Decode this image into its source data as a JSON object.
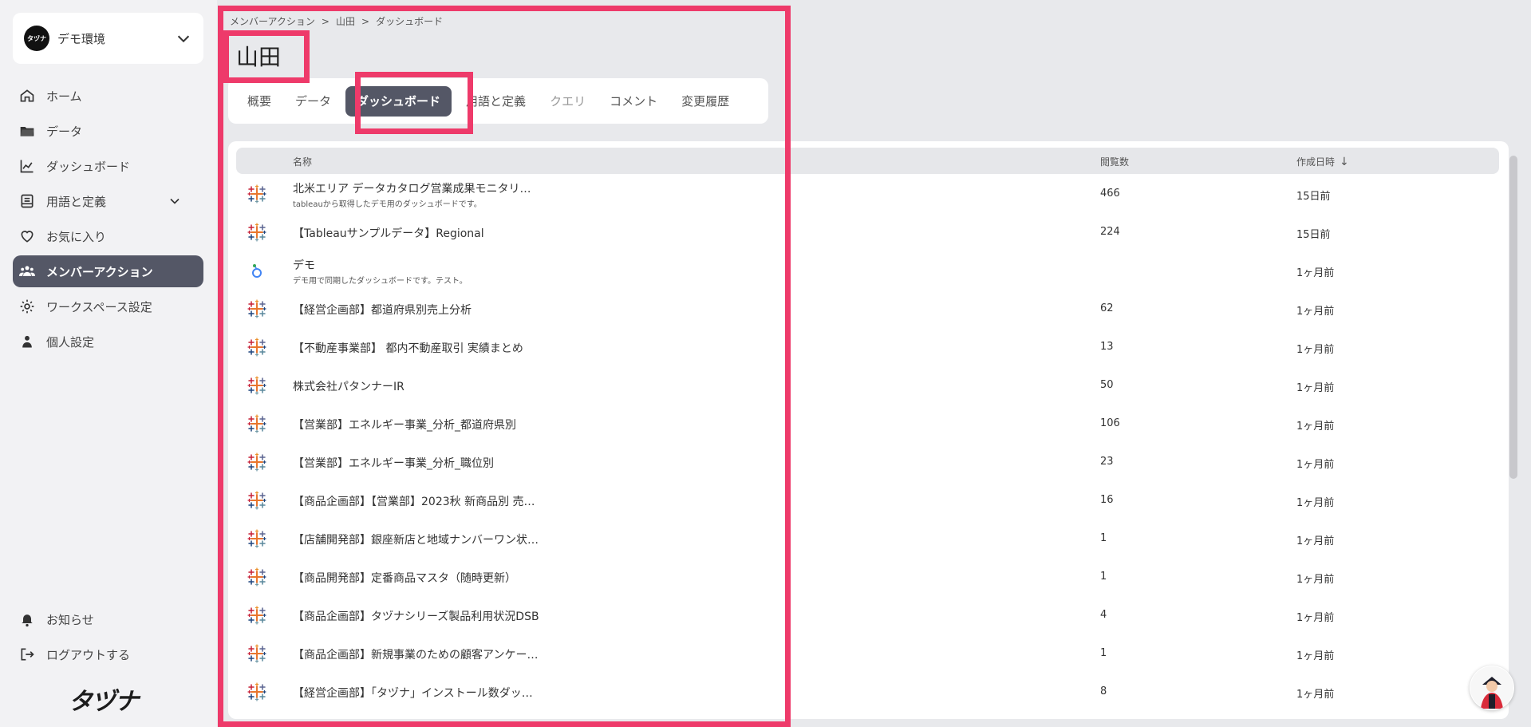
{
  "sidebar": {
    "env_logo_text": "タヅナ",
    "env_name": "デモ環境",
    "nav": [
      {
        "label": "ホーム",
        "icon": "home-icon"
      },
      {
        "label": "データ",
        "icon": "folder-icon"
      },
      {
        "label": "ダッシュボード",
        "icon": "chart-icon"
      },
      {
        "label": "用語と定義",
        "icon": "book-icon"
      },
      {
        "label": "お気に入り",
        "icon": "heart-icon"
      },
      {
        "label": "メンバーアクション",
        "icon": "users-icon",
        "active": true
      },
      {
        "label": "ワークスペース設定",
        "icon": "gear-icon"
      },
      {
        "label": "個人設定",
        "icon": "person-icon"
      }
    ],
    "bottom": [
      {
        "label": "お知らせ",
        "icon": "bell-icon"
      },
      {
        "label": "ログアウトする",
        "icon": "logout-icon"
      }
    ],
    "brand": "タヅナ"
  },
  "breadcrumb": [
    "メンバーアクション",
    "山田",
    "ダッシュボード"
  ],
  "page_title": "山田",
  "tabs": [
    {
      "label": "概要"
    },
    {
      "label": "データ"
    },
    {
      "label": "ダッシュボード",
      "active": true
    },
    {
      "label": "用語と定義"
    },
    {
      "label": "クエリ",
      "disabled": true
    },
    {
      "label": "コメント"
    },
    {
      "label": "変更履歴"
    }
  ],
  "table": {
    "headers": {
      "name": "名称",
      "views": "閲覧数",
      "created": "作成日時"
    },
    "rows": [
      {
        "title": "北米エリア データカタログ営業成果モニタリ…",
        "desc": "tableauから取得したデモ用のダッシュボードです。",
        "views": "466",
        "created": "15日前",
        "icon": "tableau-icon"
      },
      {
        "title": "【Tableauサンプルデータ】Regional",
        "desc": "",
        "views": "224",
        "created": "15日前",
        "icon": "tableau-icon"
      },
      {
        "title": "デモ",
        "desc": "デモ用で同期したダッシュボードです。テスト。",
        "views": "",
        "created": "1ヶ月前",
        "icon": "looker-icon"
      },
      {
        "title": "【経営企画部】都道府県別売上分析",
        "desc": "",
        "views": "62",
        "created": "1ヶ月前",
        "icon": "tableau-icon"
      },
      {
        "title": "【不動産事業部】 都内不動産取引 実績まとめ",
        "desc": "",
        "views": "13",
        "created": "1ヶ月前",
        "icon": "tableau-icon"
      },
      {
        "title": "株式会社パタンナーIR",
        "desc": "",
        "views": "50",
        "created": "1ヶ月前",
        "icon": "tableau-icon"
      },
      {
        "title": "【営業部】エネルギー事業_分析_都道府県別",
        "desc": "",
        "views": "106",
        "created": "1ヶ月前",
        "icon": "tableau-icon"
      },
      {
        "title": "【営業部】エネルギー事業_分析_職位別",
        "desc": "",
        "views": "23",
        "created": "1ヶ月前",
        "icon": "tableau-icon"
      },
      {
        "title": "【商品企画部】【営業部】2023秋 新商品別 売…",
        "desc": "",
        "views": "16",
        "created": "1ヶ月前",
        "icon": "tableau-icon"
      },
      {
        "title": "【店舗開発部】銀座新店と地域ナンバーワン状…",
        "desc": "",
        "views": "1",
        "created": "1ヶ月前",
        "icon": "tableau-icon"
      },
      {
        "title": "【商品開発部】定番商品マスタ（随時更新）",
        "desc": "",
        "views": "1",
        "created": "1ヶ月前",
        "icon": "tableau-icon"
      },
      {
        "title": "【商品企画部】タヅナシリーズ製品利用状況DSB",
        "desc": "",
        "views": "4",
        "created": "1ヶ月前",
        "icon": "tableau-icon"
      },
      {
        "title": "【商品企画部】新規事業のための顧客アンケー…",
        "desc": "",
        "views": "1",
        "created": "1ヶ月前",
        "icon": "tableau-icon"
      },
      {
        "title": "【経営企画部】「タヅナ」インストール数ダッ…",
        "desc": "",
        "views": "8",
        "created": "1ヶ月前",
        "icon": "tableau-icon"
      }
    ]
  },
  "colors": {
    "accent": "#545766",
    "highlight": "#ee3a6a",
    "background": "#e8e9ec"
  }
}
